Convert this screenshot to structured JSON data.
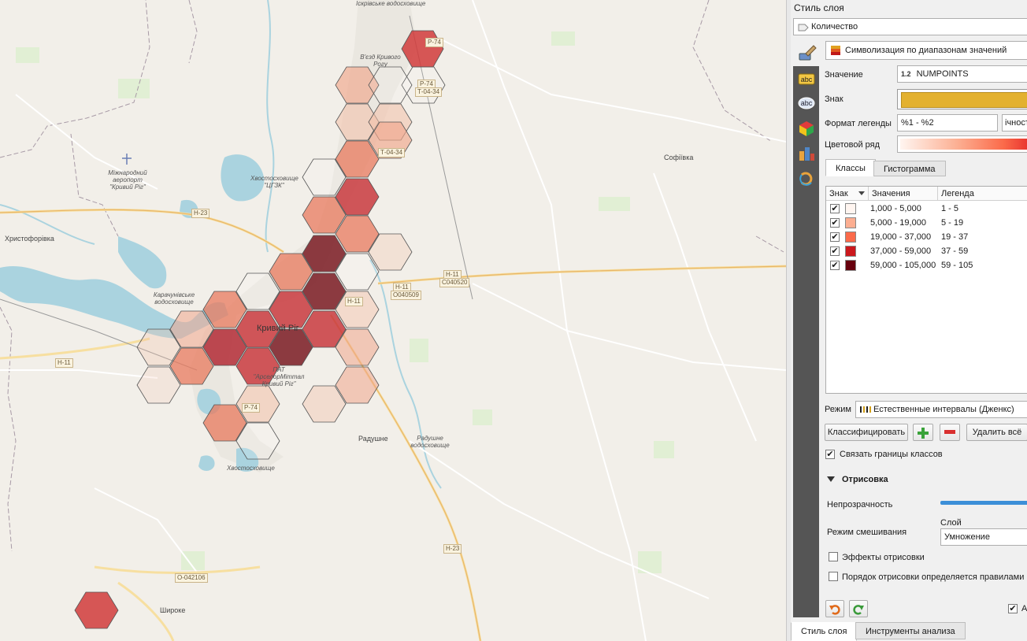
{
  "map": {
    "places": [
      {
        "name": "Кривий Ріг",
        "kind": "city"
      },
      {
        "name": "Христофорівка",
        "kind": "town"
      },
      {
        "name": "Софіївка",
        "kind": "town"
      },
      {
        "name": "Радушне",
        "kind": "town"
      },
      {
        "name": "Широке",
        "kind": "town"
      },
      {
        "name": "Міжнародний аеропорт \"Кривий Ріг\"",
        "kind": "poi"
      },
      {
        "name": "Хвостосховище \"ЦГЗК\"",
        "kind": "poi"
      },
      {
        "name": "Карачунівське водосховище",
        "kind": "poi"
      },
      {
        "name": "ПАТ \"АрселорМіттал Кривий Ріг\"",
        "kind": "poi"
      },
      {
        "name": "Хвостосховище",
        "kind": "poi"
      },
      {
        "name": "Радушне водосховище",
        "kind": "poi"
      },
      {
        "name": "В'єзд Кривого Рогу",
        "kind": "poi"
      },
      {
        "name": "Іскрівське водосховище",
        "kind": "poi"
      }
    ],
    "roads": [
      "Р-74",
      "Р-74",
      "Т-04-34",
      "Т-04-34",
      "Н-23",
      "Н-11",
      "С040520",
      "Н-11",
      "О040509",
      "Н-11",
      "Н-11",
      "Р-74",
      "Н-23",
      "О-042106"
    ]
  },
  "panel": {
    "title": "Стиль слоя",
    "layer_name": "Количество",
    "renderer": "Символизация по диапазонам значений",
    "value_label": "Значение",
    "value_field": "NUMPOINTS",
    "value_type_badge": "1.2",
    "symbol_label": "Знак",
    "symbol_color": "#e3b12f",
    "legend_format_label": "Формат легенды",
    "legend_format_value": "%1 - %2",
    "precision_stub": "ічност",
    "color_ramp_label": "Цветовой ряд",
    "tabs": [
      {
        "label": "Классы"
      },
      {
        "label": "Гистограмма"
      }
    ],
    "table_headers": [
      "Знак",
      "Значения",
      "Легенда"
    ],
    "classes": [
      {
        "color": "#fff5f0",
        "values": "1,000 - 5,000",
        "legend": "1 - 5",
        "checked": true
      },
      {
        "color": "#fcae91",
        "values": "5,000 - 19,000",
        "legend": "5 - 19",
        "checked": true
      },
      {
        "color": "#fb6a4a",
        "values": "19,000 - 37,000",
        "legend": "19 - 37",
        "checked": true
      },
      {
        "color": "#cb181d",
        "values": "37,000 - 59,000",
        "legend": "37 - 59",
        "checked": true
      },
      {
        "color": "#67000d",
        "values": "59,000 - 105,000",
        "legend": "59 - 105",
        "checked": true
      }
    ],
    "mode_label": "Режим",
    "mode_value": "Естественные интервалы (Дженкс)",
    "classify_button": "Классифицировать",
    "delete_all_button": "Удалить всё",
    "link_bounds_label": "Связать границы классов",
    "rendering_header": "Отрисовка",
    "opacity_label": "Непрозрачность",
    "opacity_value": 1.0,
    "blend_label": "Режим смешивания",
    "blend_sublabel": "Слой",
    "blend_value": "Умножение",
    "effects_label": "Эффекты отрисовки",
    "order_label": "Порядок отрисовки определяется правилами",
    "apply_stub": "А",
    "bottom_tabs": [
      {
        "label": "Стиль слоя"
      },
      {
        "label": "Инструменты анализа"
      }
    ]
  }
}
